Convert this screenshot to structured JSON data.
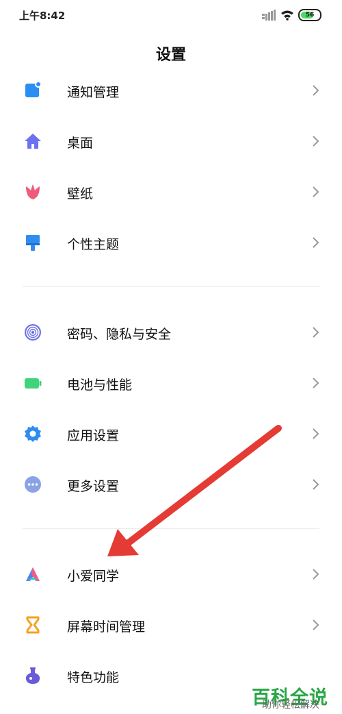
{
  "status": {
    "time": "上午8:42",
    "battery": "56"
  },
  "title": "设置",
  "groups": [
    {
      "items": [
        {
          "label": "通知管理",
          "icon": "notification-icon"
        },
        {
          "label": "桌面",
          "icon": "home-icon"
        },
        {
          "label": "壁纸",
          "icon": "tulip-icon"
        },
        {
          "label": "个性主题",
          "icon": "paint-brush-icon"
        }
      ]
    },
    {
      "items": [
        {
          "label": "密码、隐私与安全",
          "icon": "fingerprint-icon"
        },
        {
          "label": "电池与性能",
          "icon": "battery-icon"
        },
        {
          "label": "应用设置",
          "icon": "gear-icon"
        },
        {
          "label": "更多设置",
          "icon": "more-icon"
        }
      ]
    },
    {
      "items": [
        {
          "label": "小爱同学",
          "icon": "xiaoai-icon"
        },
        {
          "label": "屏幕时间管理",
          "icon": "hourglass-icon"
        },
        {
          "label": "特色功能",
          "icon": "flask-icon"
        }
      ]
    }
  ],
  "colors": {
    "notification": "#2b8ef3",
    "home": "#6b72f0",
    "tulip": "#ef5c7b",
    "brush": "#2f8df0",
    "fingerprint": "#6c73e8",
    "battery": "#3fd47a",
    "gear": "#2f8df0",
    "more": "#8aa2e6",
    "hourglass": "#f4a020",
    "flask": "#6a5bd6",
    "arrow": "#e53b35",
    "watermark": "#28a745"
  },
  "watermark": {
    "main": "百科全说",
    "sub": "助你轻松解决"
  }
}
